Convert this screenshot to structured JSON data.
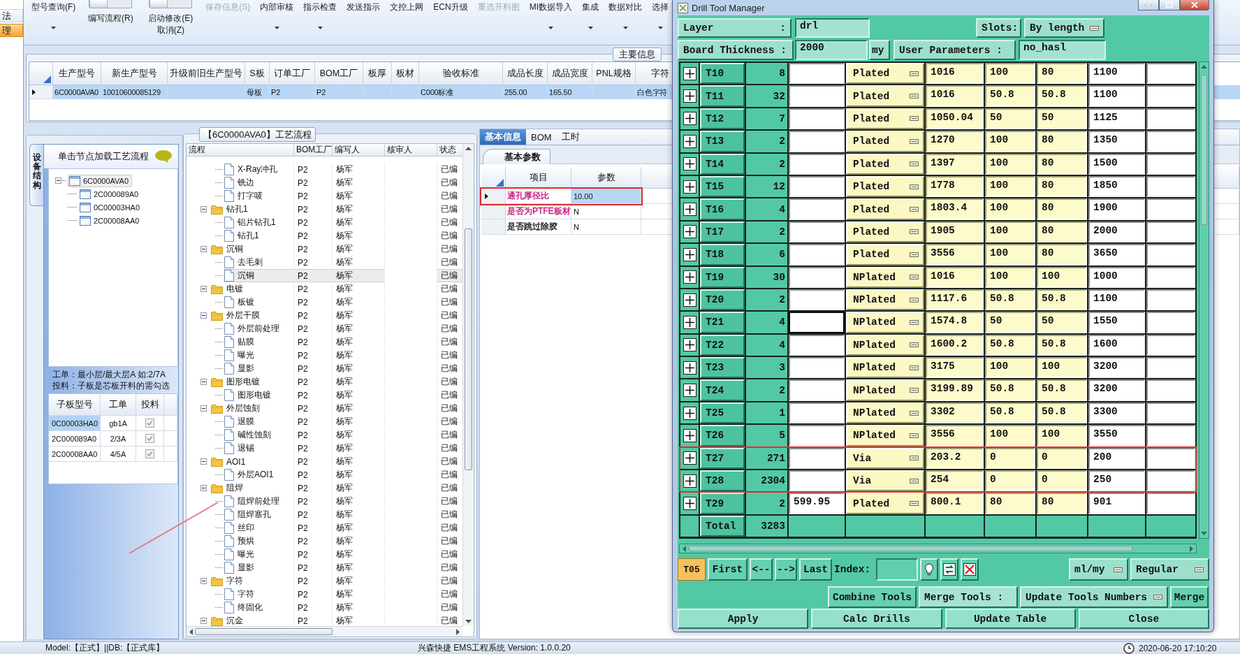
{
  "side_nav": {
    "items": [
      {
        "label": "法",
        "selected": false
      },
      {
        "label": "理",
        "selected": true
      }
    ]
  },
  "ribbon": [
    {
      "kind": "menu",
      "label": "型号查询(F)",
      "disabled": false
    },
    {
      "kind": "toggle",
      "label": "编写流程(R)",
      "on": false
    },
    {
      "kind": "toggle",
      "label": "启动修改(E)",
      "sublabel": "取消(Z)",
      "on": false
    },
    {
      "kind": "button",
      "label": "保存信息(S)",
      "disabled": true
    },
    {
      "kind": "menu",
      "label": "内部审核",
      "disabled": false
    },
    {
      "kind": "menu",
      "label": "指示检查",
      "disabled": false
    },
    {
      "kind": "button",
      "label": "发送指示",
      "disabled": false
    },
    {
      "kind": "button",
      "label": "文控上网",
      "disabled": false
    },
    {
      "kind": "button",
      "label": "ECN升级",
      "disabled": false
    },
    {
      "kind": "button",
      "label": "重选开料图",
      "disabled": true
    },
    {
      "kind": "menu",
      "label": "MI数据导入",
      "disabled": false
    },
    {
      "kind": "menu",
      "label": "集成",
      "disabled": false
    },
    {
      "kind": "menu",
      "label": "数据对比",
      "disabled": false
    },
    {
      "kind": "menu",
      "label": "选择",
      "disabled": false
    }
  ],
  "main_info": {
    "title": "主要信息",
    "columns": [
      "生产型号",
      "新生产型号",
      "升级前旧生产型号",
      "S板",
      "订单工厂",
      "BOM工厂",
      "板厚",
      "板材",
      "验收标准",
      "成品长度",
      "成品宽度",
      "PNL规格",
      "字符"
    ],
    "rows": [
      {
        "selected": true,
        "cells": [
          "6C0000AVA0",
          "10010600085129",
          null,
          "母板",
          "P2",
          "P2",
          null,
          null,
          "C000标准",
          "255.00",
          "165.50",
          null,
          "白色字符"
        ]
      }
    ]
  },
  "structure_panel": {
    "tab": "设备结构",
    "hint": "单击节点加载工艺流程",
    "tree": [
      {
        "label": "6C0000AVA0",
        "selected": true,
        "expanded": true,
        "children": [
          {
            "label": "2C000089A0",
            "selected": false
          },
          {
            "label": "0C00003HA0",
            "selected": false
          },
          {
            "label": "2C00008AA0",
            "selected": false
          }
        ]
      }
    ],
    "notes": [
      "工单：最小层/最大层A 如:2/7A",
      "投料：子板是芯板开料的需勾选"
    ],
    "sub_boards": {
      "columns": [
        "子板型号",
        "工单",
        "投料"
      ],
      "rows": [
        {
          "model": "0C00003HA0",
          "order": "gb1A",
          "feed": true,
          "selected": true
        },
        {
          "model": "2C000089A0",
          "order": "2/3A",
          "feed": true,
          "selected": false
        },
        {
          "model": "2C00008AA0",
          "order": "4/5A",
          "feed": true,
          "selected": false
        }
      ]
    }
  },
  "process_flow": {
    "title": "【6C0000AVA0】工艺流程",
    "columns": [
      "流程",
      "BOM工厂",
      "编写人",
      "核审人",
      "状态"
    ],
    "steps": [
      {
        "children": [
          {
            "kind": "step",
            "name": "X-Ray冲孔",
            "factory": "P2",
            "author": "杨军",
            "status": "已编",
            "selected": false
          },
          {
            "kind": "step",
            "name": "铣边",
            "factory": "P2",
            "author": "杨军",
            "status": "已编",
            "selected": false
          },
          {
            "kind": "step",
            "name": "打字唛",
            "factory": "P2",
            "author": "杨军",
            "status": "已编",
            "selected": false
          }
        ]
      },
      {
        "kind": "folder",
        "name": "钻孔1",
        "factory": "P2",
        "author": "杨军",
        "status": "已编",
        "selected": false,
        "expanded": true,
        "children": [
          {
            "kind": "step",
            "name": "铝片钻孔1",
            "factory": "P2",
            "author": "杨军",
            "status": "已编",
            "selected": false
          },
          {
            "kind": "step",
            "name": "钻孔1",
            "factory": "P2",
            "author": "杨军",
            "status": "已编",
            "selected": false
          }
        ]
      },
      {
        "kind": "folder",
        "name": "沉铜",
        "factory": "P2",
        "author": "杨军",
        "status": "已编",
        "selected": false,
        "expanded": true,
        "children": [
          {
            "kind": "step",
            "name": "去毛刺",
            "factory": "P2",
            "author": "杨军",
            "status": "已编",
            "selected": false
          },
          {
            "kind": "step",
            "name": "沉铜",
            "factory": "P2",
            "author": "杨军",
            "status": "已编",
            "selected": true
          }
        ]
      },
      {
        "kind": "folder",
        "name": "电镀",
        "factory": "P2",
        "author": "杨军",
        "status": "已编",
        "selected": false,
        "expanded": true,
        "children": [
          {
            "kind": "step",
            "name": "板镀",
            "factory": "P2",
            "author": "杨军",
            "status": "已编",
            "selected": false
          }
        ]
      },
      {
        "kind": "folder",
        "name": "外层干膜",
        "factory": "P2",
        "author": "杨军",
        "status": "已编",
        "selected": false,
        "expanded": true,
        "children": [
          {
            "kind": "step",
            "name": "外层前处理",
            "factory": "P2",
            "author": "杨军",
            "status": "已编",
            "selected": false
          },
          {
            "kind": "step",
            "name": "贴膜",
            "factory": "P2",
            "author": "杨军",
            "status": "已编",
            "selected": false
          },
          {
            "kind": "step",
            "name": "曝光",
            "factory": "P2",
            "author": "杨军",
            "status": "已编",
            "selected": false
          },
          {
            "kind": "step",
            "name": "显影",
            "factory": "P2",
            "author": "杨军",
            "status": "已编",
            "selected": false
          }
        ]
      },
      {
        "kind": "folder",
        "name": "图形电镀",
        "factory": "P2",
        "author": "杨军",
        "status": "已编",
        "selected": false,
        "expanded": true,
        "children": [
          {
            "kind": "step",
            "name": "图形电镀",
            "factory": "P2",
            "author": "杨军",
            "status": "已编",
            "selected": false
          }
        ]
      },
      {
        "kind": "folder",
        "name": "外层蚀刻",
        "factory": "P2",
        "author": "杨军",
        "status": "已编",
        "selected": false,
        "expanded": true,
        "children": [
          {
            "kind": "step",
            "name": "退膜",
            "factory": "P2",
            "author": "杨军",
            "status": "已编",
            "selected": false
          },
          {
            "kind": "step",
            "name": "碱性蚀刻",
            "factory": "P2",
            "author": "杨军",
            "status": "已编",
            "selected": false
          },
          {
            "kind": "step",
            "name": "退锡",
            "factory": "P2",
            "author": "杨军",
            "status": "已编",
            "selected": false
          }
        ]
      },
      {
        "kind": "folder",
        "name": "AOI1",
        "factory": "P2",
        "author": "杨军",
        "status": "已编",
        "selected": false,
        "expanded": true,
        "children": [
          {
            "kind": "step",
            "name": "外层AOI1",
            "factory": "P2",
            "author": "杨军",
            "status": "已编",
            "selected": false
          }
        ]
      },
      {
        "kind": "folder",
        "name": "阻焊",
        "factory": "P2",
        "author": "杨军",
        "status": "已编",
        "selected": false,
        "expanded": true,
        "children": [
          {
            "kind": "step",
            "name": "阻焊前处理",
            "factory": "P2",
            "author": "杨军",
            "status": "已编",
            "selected": false
          },
          {
            "kind": "step",
            "name": "阻焊塞孔",
            "factory": "P2",
            "author": "杨军",
            "status": "已编",
            "selected": false
          },
          {
            "kind": "step",
            "name": "丝印",
            "factory": "P2",
            "author": "杨军",
            "status": "已编",
            "selected": false
          },
          {
            "kind": "step",
            "name": "预烘",
            "factory": "P2",
            "author": "杨军",
            "status": "已编",
            "selected": false
          },
          {
            "kind": "step",
            "name": "曝光",
            "factory": "P2",
            "author": "杨军",
            "status": "已编",
            "selected": false
          },
          {
            "kind": "step",
            "name": "显影",
            "factory": "P2",
            "author": "杨军",
            "status": "已编",
            "selected": false
          }
        ]
      },
      {
        "kind": "folder",
        "name": "字符",
        "factory": "P2",
        "author": "杨军",
        "status": "已编",
        "selected": false,
        "expanded": true,
        "children": [
          {
            "kind": "step",
            "name": "字符",
            "factory": "P2",
            "author": "杨军",
            "status": "已编",
            "selected": false
          },
          {
            "kind": "step",
            "name": "终固化",
            "factory": "P2",
            "author": "杨军",
            "status": "已编",
            "selected": false
          }
        ]
      },
      {
        "kind": "folder",
        "name": "沉金",
        "factory": "P2",
        "author": "杨军",
        "status": "已编",
        "selected": false,
        "expanded": true
      }
    ]
  },
  "detail_panel": {
    "tabs": [
      {
        "label": "基本信息",
        "selected": true
      },
      {
        "label": "BOM",
        "selected": false
      },
      {
        "label": "工时",
        "selected": false
      }
    ],
    "section": "基本参数",
    "columns": [
      "项目",
      "参数"
    ],
    "rows": [
      {
        "item": "通孔厚径比",
        "value": "10.00",
        "color": "#c2187e",
        "selected": true,
        "highlighted": true
      },
      {
        "item": "是否为PTFE板材",
        "value": "N",
        "color": "#c2187e",
        "selected": false,
        "highlighted": false
      },
      {
        "item": "是否跳过除胶",
        "value": "N",
        "color": "#111111",
        "selected": false,
        "highlighted": false
      }
    ]
  },
  "status_bar": {
    "model": "Model:【正式】||DB:【正式库】",
    "version": "兴森快捷 EMS工程系统 Version: 1.0.0.20",
    "datetime": "2020-06-20 17:10:20"
  },
  "drill_tool_manager": {
    "title": "Drill Tool Manager",
    "layer": {
      "label": "Layer",
      "separator": ":",
      "value": "drl"
    },
    "slots": {
      "label": "Slots:",
      "value": "By length"
    },
    "board_thickness": {
      "label": "Board Thickness :",
      "value": "2000",
      "unit": "my"
    },
    "user_parameters": {
      "label": "User Parameters :",
      "value": "no_hasl"
    },
    "tools": [
      {
        "tool": "T10",
        "column_3": "8",
        "column_5": "Plated",
        "column_6": "1016",
        "column_7": "100",
        "column_8": "80",
        "column_9": "1100",
        "focused": false,
        "highlighted": false
      },
      {
        "tool": "T11",
        "column_3": "32",
        "column_5": "Plated",
        "column_6": "1016",
        "column_7": "50.8",
        "column_8": "50.8",
        "column_9": "1100",
        "focused": false,
        "highlighted": false
      },
      {
        "tool": "T12",
        "column_3": "7",
        "column_5": "Plated",
        "column_6": "1050.04",
        "column_7": "50",
        "column_8": "50",
        "column_9": "1125",
        "focused": false,
        "highlighted": false
      },
      {
        "tool": "T13",
        "column_3": "2",
        "column_5": "Plated",
        "column_6": "1270",
        "column_7": "100",
        "column_8": "80",
        "column_9": "1350",
        "focused": false,
        "highlighted": false
      },
      {
        "tool": "T14",
        "column_3": "2",
        "column_5": "Plated",
        "column_6": "1397",
        "column_7": "100",
        "column_8": "80",
        "column_9": "1500",
        "focused": false,
        "highlighted": false
      },
      {
        "tool": "T15",
        "column_3": "12",
        "column_5": "Plated",
        "column_6": "1778",
        "column_7": "100",
        "column_8": "80",
        "column_9": "1850",
        "focused": false,
        "highlighted": false
      },
      {
        "tool": "T16",
        "column_3": "4",
        "column_5": "Plated",
        "column_6": "1803.4",
        "column_7": "100",
        "column_8": "80",
        "column_9": "1900",
        "focused": false,
        "highlighted": false
      },
      {
        "tool": "T17",
        "column_3": "2",
        "column_5": "Plated",
        "column_6": "1905",
        "column_7": "100",
        "column_8": "80",
        "column_9": "2000",
        "focused": false,
        "highlighted": false
      },
      {
        "tool": "T18",
        "column_3": "6",
        "column_5": "Plated",
        "column_6": "3556",
        "column_7": "100",
        "column_8": "80",
        "column_9": "3650",
        "focused": false,
        "highlighted": false
      },
      {
        "tool": "T19",
        "column_3": "30",
        "column_5": "NPlated",
        "column_6": "1016",
        "column_7": "100",
        "column_8": "100",
        "column_9": "1000",
        "focused": false,
        "highlighted": false
      },
      {
        "tool": "T20",
        "column_3": "2",
        "column_5": "NPlated",
        "column_6": "1117.6",
        "column_7": "50.8",
        "column_8": "50.8",
        "column_9": "1100",
        "focused": false,
        "highlighted": false
      },
      {
        "tool": "T21",
        "column_3": "4",
        "column_5": "NPlated",
        "column_6": "1574.8",
        "column_7": "50",
        "column_8": "50",
        "column_9": "1550",
        "focused": true,
        "highlighted": false
      },
      {
        "tool": "T22",
        "column_3": "4",
        "column_5": "NPlated",
        "column_6": "1600.2",
        "column_7": "50.8",
        "column_8": "50.8",
        "column_9": "1600",
        "focused": false,
        "highlighted": false
      },
      {
        "tool": "T23",
        "column_3": "3",
        "column_5": "NPlated",
        "column_6": "3175",
        "column_7": "100",
        "column_8": "100",
        "column_9": "3200",
        "focused": false,
        "highlighted": false
      },
      {
        "tool": "T24",
        "column_3": "2",
        "column_5": "NPlated",
        "column_6": "3199.89",
        "column_7": "50.8",
        "column_8": "50.8",
        "column_9": "3200",
        "focused": false,
        "highlighted": false
      },
      {
        "tool": "T25",
        "column_3": "1",
        "column_5": "NPlated",
        "column_6": "3302",
        "column_7": "50.8",
        "column_8": "50.8",
        "column_9": "3300",
        "focused": false,
        "highlighted": false
      },
      {
        "tool": "T26",
        "column_3": "5",
        "column_5": "NPlated",
        "column_6": "3556",
        "column_7": "100",
        "column_8": "100",
        "column_9": "3550",
        "focused": false,
        "highlighted": false
      },
      {
        "tool": "T27",
        "column_3": "271",
        "column_5": "Via",
        "column_6": "203.2",
        "column_7": "0",
        "column_8": "0",
        "column_9": "200",
        "focused": false,
        "highlighted": true
      },
      {
        "tool": "T28",
        "column_3": "2304",
        "column_5": "Via",
        "column_6": "254",
        "column_7": "0",
        "column_8": "0",
        "column_9": "250",
        "focused": false,
        "highlighted": true
      },
      {
        "tool": "T29",
        "column_3": "2",
        "column_4": "599.95",
        "column_5": "Plated",
        "column_6": "800.1",
        "column_7": "80",
        "column_8": "80",
        "column_9": "901",
        "focused": false,
        "highlighted": false
      }
    ],
    "total": {
      "label": "Total",
      "column_3": "3283"
    },
    "navigation": {
      "current": "T05",
      "buttons": [
        "First",
        "<--",
        "-->",
        "Last"
      ],
      "index_label": "Index:",
      "units": "ml/my",
      "mode": "Regular"
    },
    "merge": {
      "combine_button": "Combine Tools",
      "label": "Merge Tools :",
      "option": "Update Tools Numbers",
      "button": "Merge"
    },
    "actions": [
      "Apply",
      "Calc Drills",
      "Update Table",
      "Close"
    ]
  }
}
